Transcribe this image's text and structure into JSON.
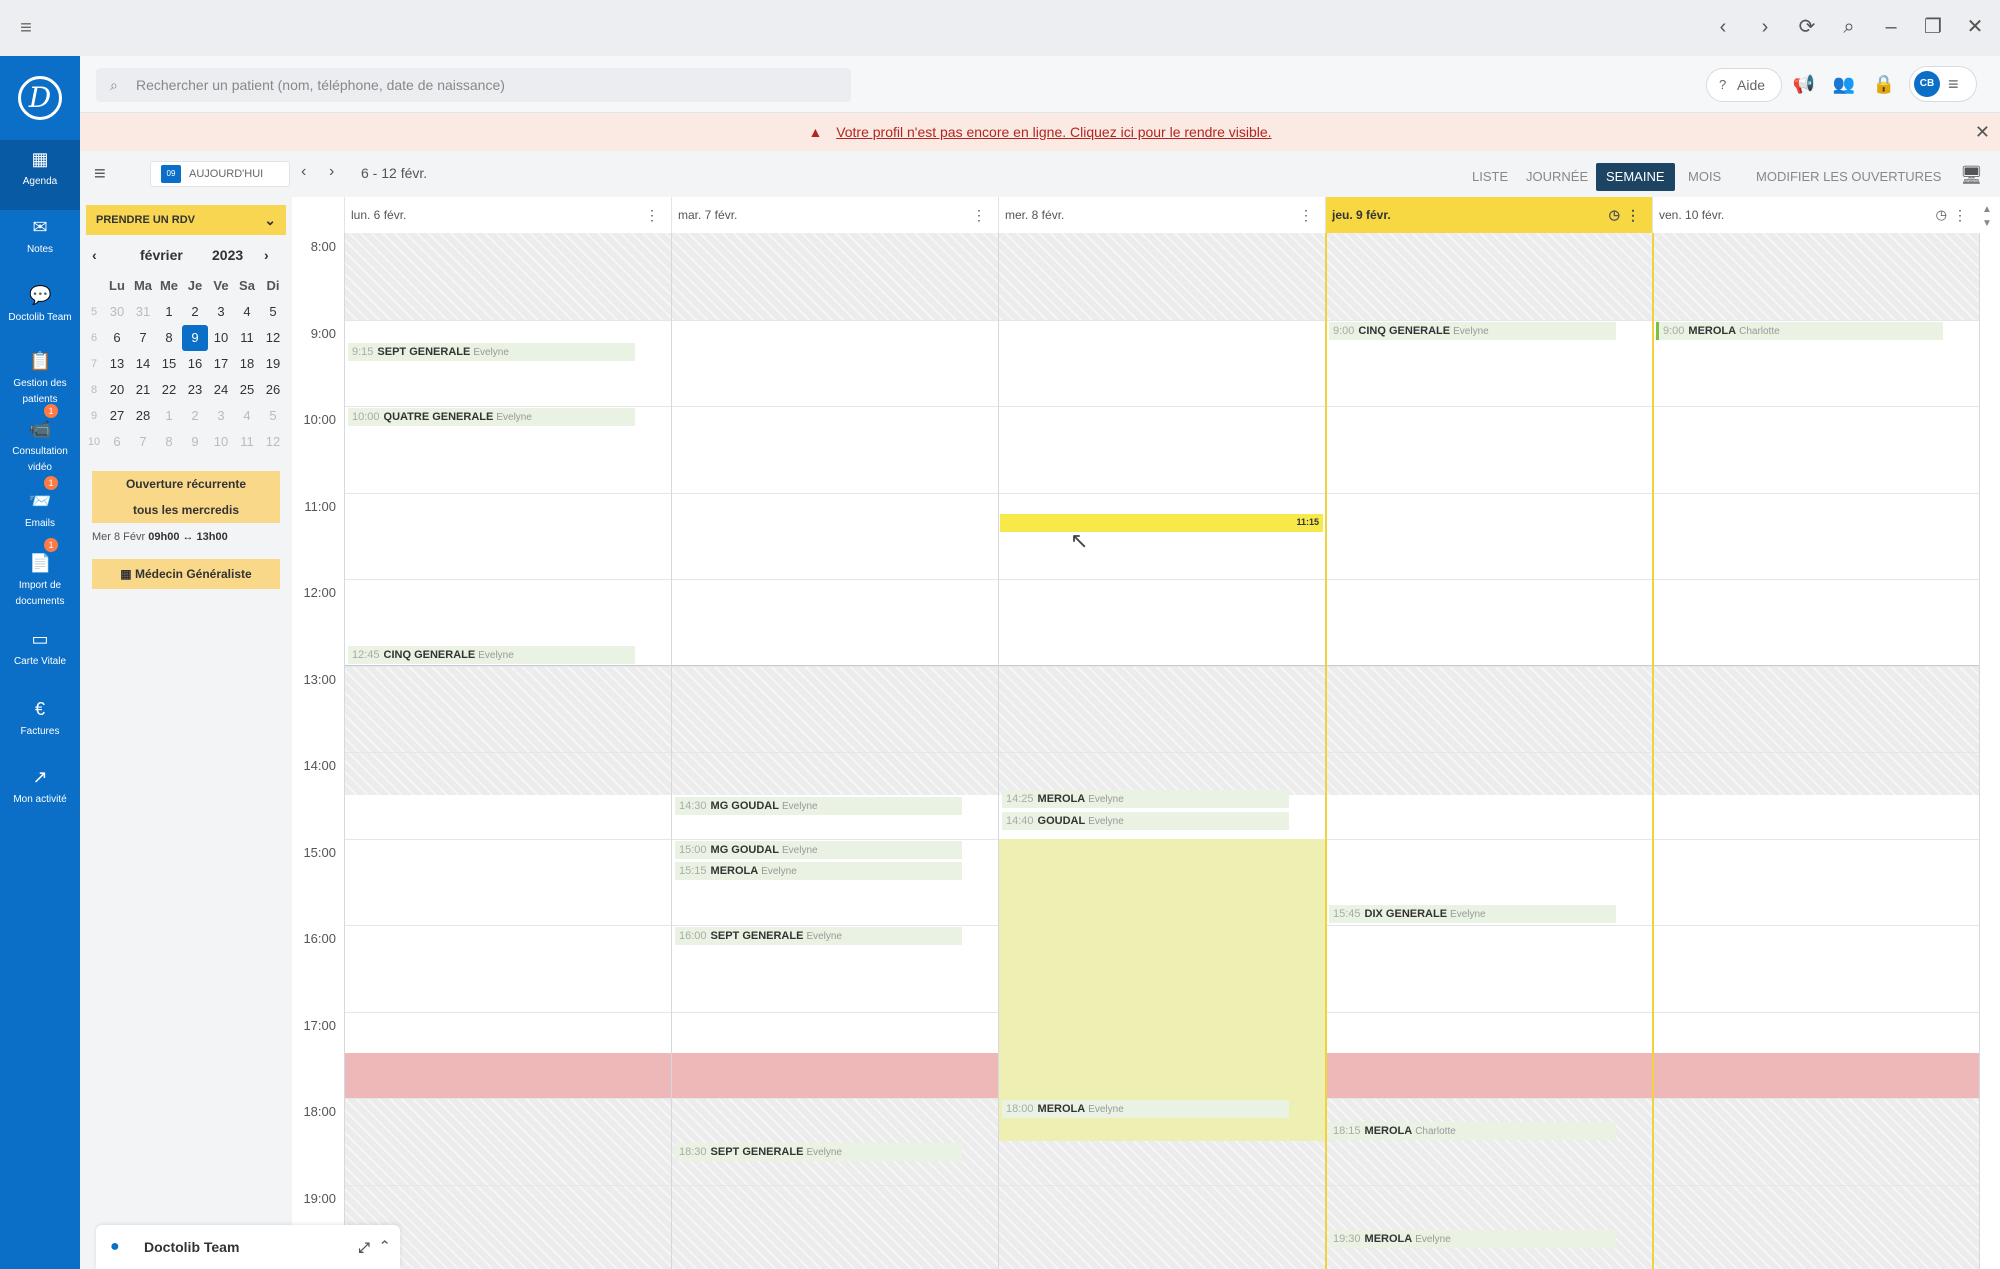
{
  "titlebar": {
    "menu_icon": "hamburger-icon",
    "icons": [
      "back-icon",
      "forward-icon",
      "refresh-icon",
      "search-icon",
      "minimize-icon",
      "restore-icon",
      "close-icon"
    ]
  },
  "sidebar": {
    "logo": "D",
    "items": [
      {
        "label": "Agenda",
        "icon": "▦",
        "badge": ""
      },
      {
        "label": "Notes",
        "icon": "✉",
        "badge": ""
      },
      {
        "label": "Doctolib Team",
        "icon": "💬",
        "badge": ""
      },
      {
        "label": "Gestion des patients",
        "icon": "📋",
        "badge": ""
      },
      {
        "label": "Consultation vidéo",
        "icon": "📹",
        "badge": "1"
      },
      {
        "label": "Emails",
        "icon": "📨",
        "badge": "1"
      },
      {
        "label": "Import de documents",
        "icon": "📄",
        "badge": "1"
      },
      {
        "label": "Carte Vitale",
        "icon": "▭",
        "badge": ""
      },
      {
        "label": "Factures",
        "icon": "€",
        "badge": ""
      },
      {
        "label": "Mon activité",
        "icon": "↗",
        "badge": ""
      }
    ]
  },
  "search": {
    "placeholder": "Rechercher un patient (nom, téléphone, date de naissance)"
  },
  "topbar": {
    "help_label": "Aide",
    "avatar_initials": "CB"
  },
  "banner": {
    "text": "Votre profil n'est pas encore en ligne. Cliquez ici pour le rendre visible."
  },
  "toolbar": {
    "today_badge": "09",
    "today_label": "AUJOURD'HUI",
    "range": "6 - 12 févr.",
    "tabs": [
      "LISTE",
      "JOURNÉE",
      "SEMAINE",
      "MOIS",
      "MODIFIER LES OUVERTURES"
    ],
    "active_tab": "SEMAINE"
  },
  "leftpanel": {
    "rdv_label": "PRENDRE UN RDV",
    "month": "février",
    "year": "2023",
    "weekdays": [
      "Lu",
      "Ma",
      "Me",
      "Je",
      "Ve",
      "Sa",
      "Di"
    ],
    "weeks": [
      {
        "wk": "5",
        "days": [
          "30",
          "31",
          "1",
          "2",
          "3",
          "4",
          "5"
        ]
      },
      {
        "wk": "6",
        "days": [
          "6",
          "7",
          "8",
          "9",
          "10",
          "11",
          "12"
        ]
      },
      {
        "wk": "7",
        "days": [
          "13",
          "14",
          "15",
          "16",
          "17",
          "18",
          "19"
        ]
      },
      {
        "wk": "8",
        "days": [
          "20",
          "21",
          "22",
          "23",
          "24",
          "25",
          "26"
        ]
      },
      {
        "wk": "9",
        "days": [
          "27",
          "28",
          "1",
          "2",
          "3",
          "4",
          "5"
        ]
      },
      {
        "wk": "10",
        "days": [
          "6",
          "7",
          "8",
          "9",
          "10",
          "11",
          "12"
        ]
      }
    ],
    "selected_day": "9",
    "open_line1": "Ouverture récurrente",
    "open_line2": "tous les mercredis",
    "open_detail_prefix": "Mer 8 Févr",
    "open_detail_hours": "09h00 ↔ 13h00",
    "med_label": "Médecin Généraliste",
    "team_label": "Doctolib Team"
  },
  "calendar": {
    "days": [
      "lun. 6 févr.",
      "mar. 7 févr.",
      "mer. 8 févr.",
      "jeu. 9 févr.",
      "ven. 10 févr."
    ],
    "today_index": 3,
    "hours": [
      "8:00",
      "9:00",
      "10:00",
      "11:00",
      "12:00",
      "13:00",
      "14:00",
      "15:00",
      "16:00",
      "17:00",
      "18:00",
      "19:00"
    ],
    "selected_slot_label": "11:15",
    "appointments": [
      {
        "day": 0,
        "time": "9:15",
        "name": "SEPT GENERALE",
        "practitioner": "Evelyne"
      },
      {
        "day": 0,
        "time": "10:00",
        "name": "QUATRE GENERALE",
        "practitioner": "Evelyne"
      },
      {
        "day": 0,
        "time": "12:45",
        "name": "CINQ GENERALE",
        "practitioner": "Evelyne"
      },
      {
        "day": 1,
        "time": "14:30",
        "name": "MG GOUDAL",
        "practitioner": "Evelyne"
      },
      {
        "day": 1,
        "time": "15:00",
        "name": "MG GOUDAL",
        "practitioner": "Evelyne"
      },
      {
        "day": 1,
        "time": "15:15",
        "name": "MEROLA",
        "practitioner": "Evelyne"
      },
      {
        "day": 1,
        "time": "16:00",
        "name": "SEPT GENERALE",
        "practitioner": "Evelyne"
      },
      {
        "day": 1,
        "time": "18:30",
        "name": "SEPT GENERALE",
        "practitioner": "Evelyne"
      },
      {
        "day": 2,
        "time": "14:25",
        "name": "MEROLA",
        "practitioner": "Evelyne"
      },
      {
        "day": 2,
        "time": "14:40",
        "name": "GOUDAL",
        "practitioner": "Evelyne"
      },
      {
        "day": 2,
        "time": "18:00",
        "name": "MEROLA",
        "practitioner": "Evelyne"
      },
      {
        "day": 3,
        "time": "9:00",
        "name": "CINQ GENERALE",
        "practitioner": "Evelyne"
      },
      {
        "day": 3,
        "time": "15:45",
        "name": "DIX GENERALE",
        "practitioner": "Evelyne"
      },
      {
        "day": 3,
        "time": "18:15",
        "name": "MEROLA",
        "practitioner": "Charlotte"
      },
      {
        "day": 3,
        "time": "19:30",
        "name": "MEROLA",
        "practitioner": "Evelyne"
      },
      {
        "day": 4,
        "time": "9:00",
        "name": "MEROLA",
        "practitioner": "Charlotte"
      }
    ]
  },
  "colors": {
    "sidebar": "#0b6ec7",
    "accent_yellow": "#f7d842",
    "active_tab": "#1d4463",
    "lunch": "#eeb8b8",
    "appointment": "#eaf2e3"
  }
}
